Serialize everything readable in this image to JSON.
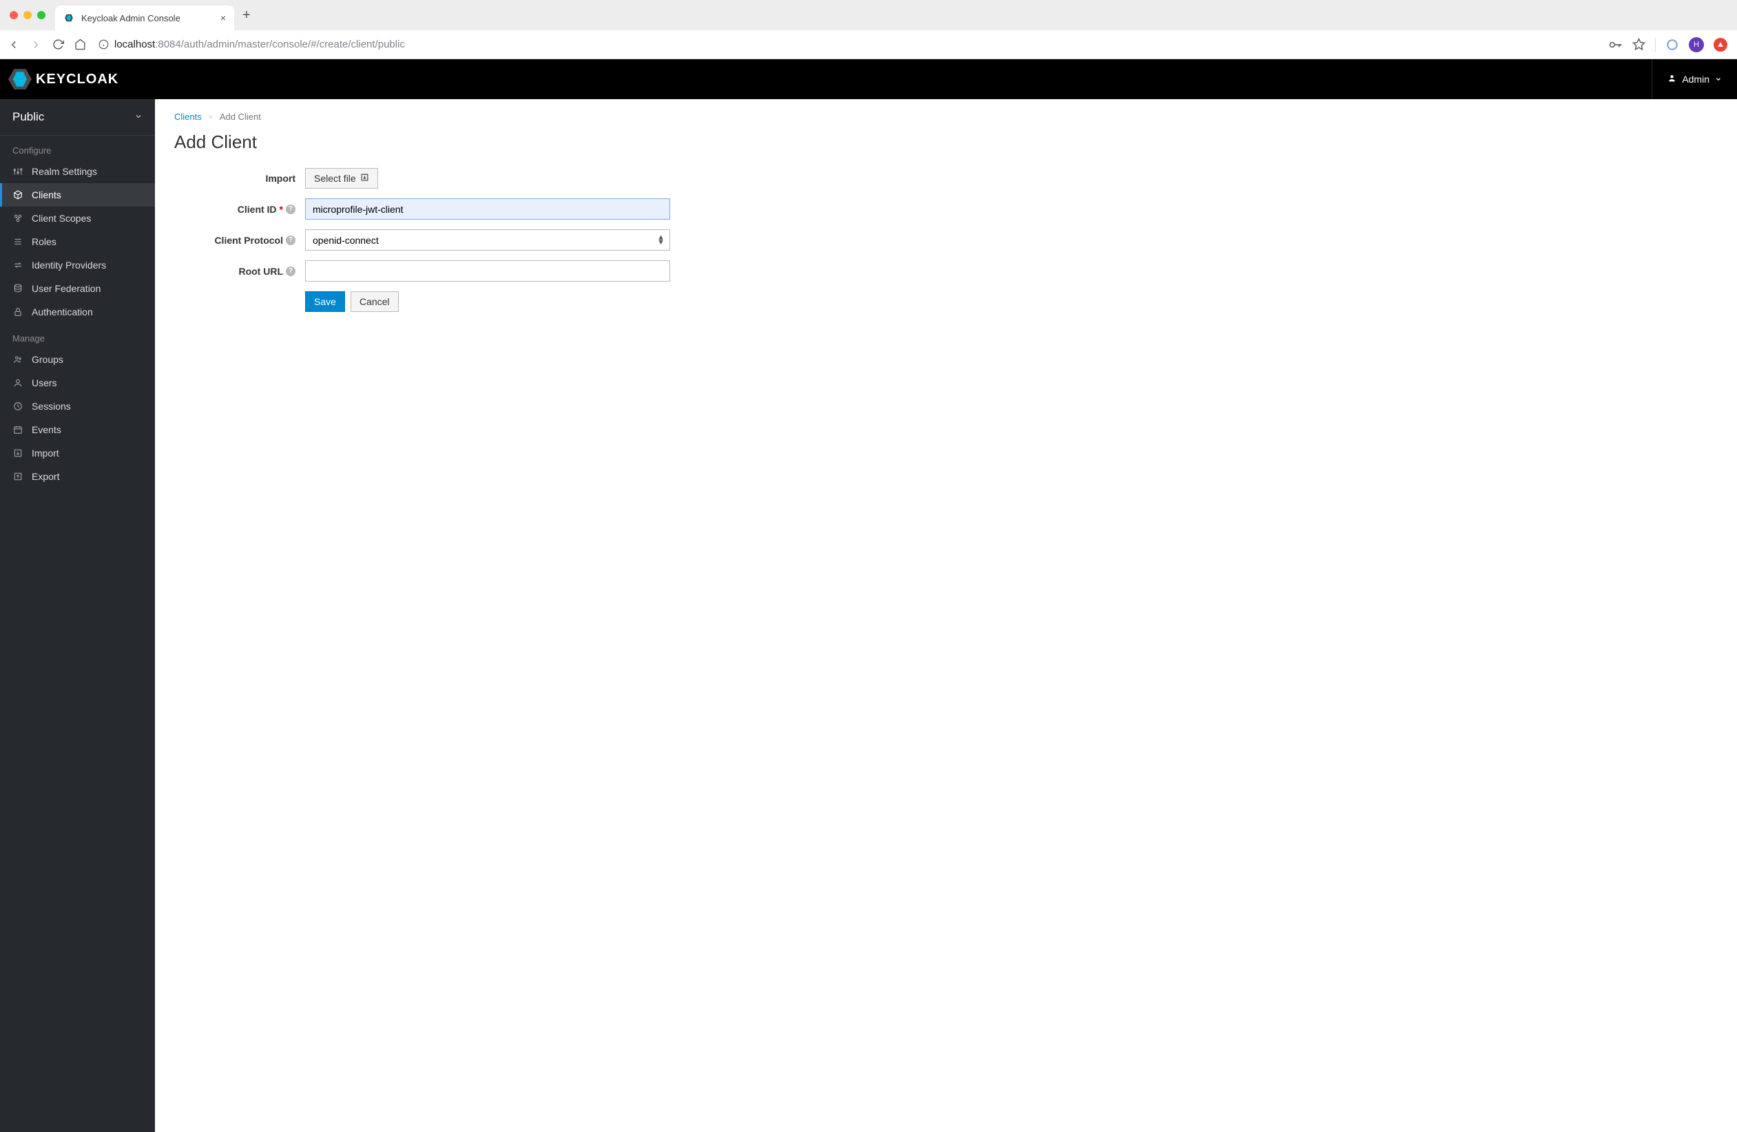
{
  "browser": {
    "tab_title": "Keycloak Admin Console",
    "url_prefix": "localhost",
    "url_rest": ":8084/auth/admin/master/console/#/create/client/public",
    "avatar_letter": "H"
  },
  "header": {
    "brand": "KEYCLOAK",
    "user_label": "Admin"
  },
  "sidebar": {
    "realm": "Public",
    "section_configure": "Configure",
    "section_manage": "Manage",
    "configure_items": [
      {
        "label": "Realm Settings",
        "icon": "sliders"
      },
      {
        "label": "Clients",
        "icon": "cube",
        "active": true
      },
      {
        "label": "Client Scopes",
        "icon": "scopes"
      },
      {
        "label": "Roles",
        "icon": "list"
      },
      {
        "label": "Identity Providers",
        "icon": "exchange"
      },
      {
        "label": "User Federation",
        "icon": "database"
      },
      {
        "label": "Authentication",
        "icon": "lock"
      }
    ],
    "manage_items": [
      {
        "label": "Groups",
        "icon": "group"
      },
      {
        "label": "Users",
        "icon": "user"
      },
      {
        "label": "Sessions",
        "icon": "clock"
      },
      {
        "label": "Events",
        "icon": "calendar"
      },
      {
        "label": "Import",
        "icon": "import"
      },
      {
        "label": "Export",
        "icon": "export"
      }
    ]
  },
  "breadcrumb": {
    "clients": "Clients",
    "current": "Add Client"
  },
  "page": {
    "title": "Add Client"
  },
  "form": {
    "import_label": "Import",
    "select_file_label": "Select file",
    "client_id_label": "Client ID",
    "client_id_value": "microprofile-jwt-client",
    "client_protocol_label": "Client Protocol",
    "client_protocol_value": "openid-connect",
    "root_url_label": "Root URL",
    "root_url_value": "",
    "save_label": "Save",
    "cancel_label": "Cancel"
  }
}
